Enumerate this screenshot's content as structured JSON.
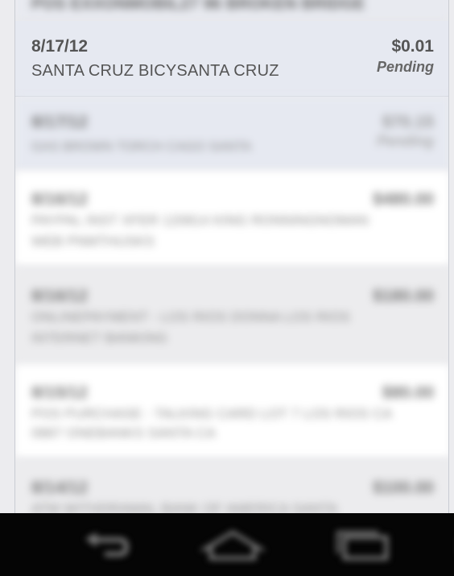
{
  "transactions": [
    {
      "date": "",
      "description": "POS EXXONMOBIL27 96 BROKEN BRIDGE",
      "amount": "",
      "status": "",
      "row_color": "#e8eaf0"
    },
    {
      "date": "8/17/12",
      "description": "SANTA CRUZ BICYSANTA CRUZ",
      "amount": "$0.01",
      "status": "Pending",
      "row_color": "#e6e9f1"
    },
    {
      "date": "8/17/12",
      "description": "GAS BROWN TORCH CAGO SANTA",
      "amount": "$70.15",
      "status": "Pending",
      "row_color": "#e6e9f1"
    },
    {
      "date": "8/16/12",
      "description": "PAYPAL INST XFER 120814 KING RONNINGNOMAN",
      "description2": "WEB PNMTHUSKS",
      "amount": "$480.00",
      "status": "",
      "row_color": "#ffffff"
    },
    {
      "date": "8/16/12",
      "description": "ONLINEPAYMENT - LOS RIOS DONNA LOS RIOS",
      "description2": "INTERNET BANKING",
      "amount": "$180.00",
      "status": "",
      "row_color": "#ececee"
    },
    {
      "date": "8/15/12",
      "description": "POS PURCHASE - TALKING CARD LOT 7 LOS RIOS CA",
      "description2": "0887 ONEBANKS SANTA CA",
      "amount": "$80.00",
      "status": "",
      "row_color": "#ffffff"
    },
    {
      "date": "8/14/12",
      "description": "ATM WITHDRAWAL BANK OF AMERICA SANTA",
      "description2": "",
      "amount": "$100.00",
      "status": "",
      "row_color": "#ececee"
    }
  ],
  "nav": {
    "back_icon": "back-arrow-icon",
    "home_icon": "home-icon",
    "recents_icon": "recent-apps-icon",
    "bar_color": "#050505"
  }
}
